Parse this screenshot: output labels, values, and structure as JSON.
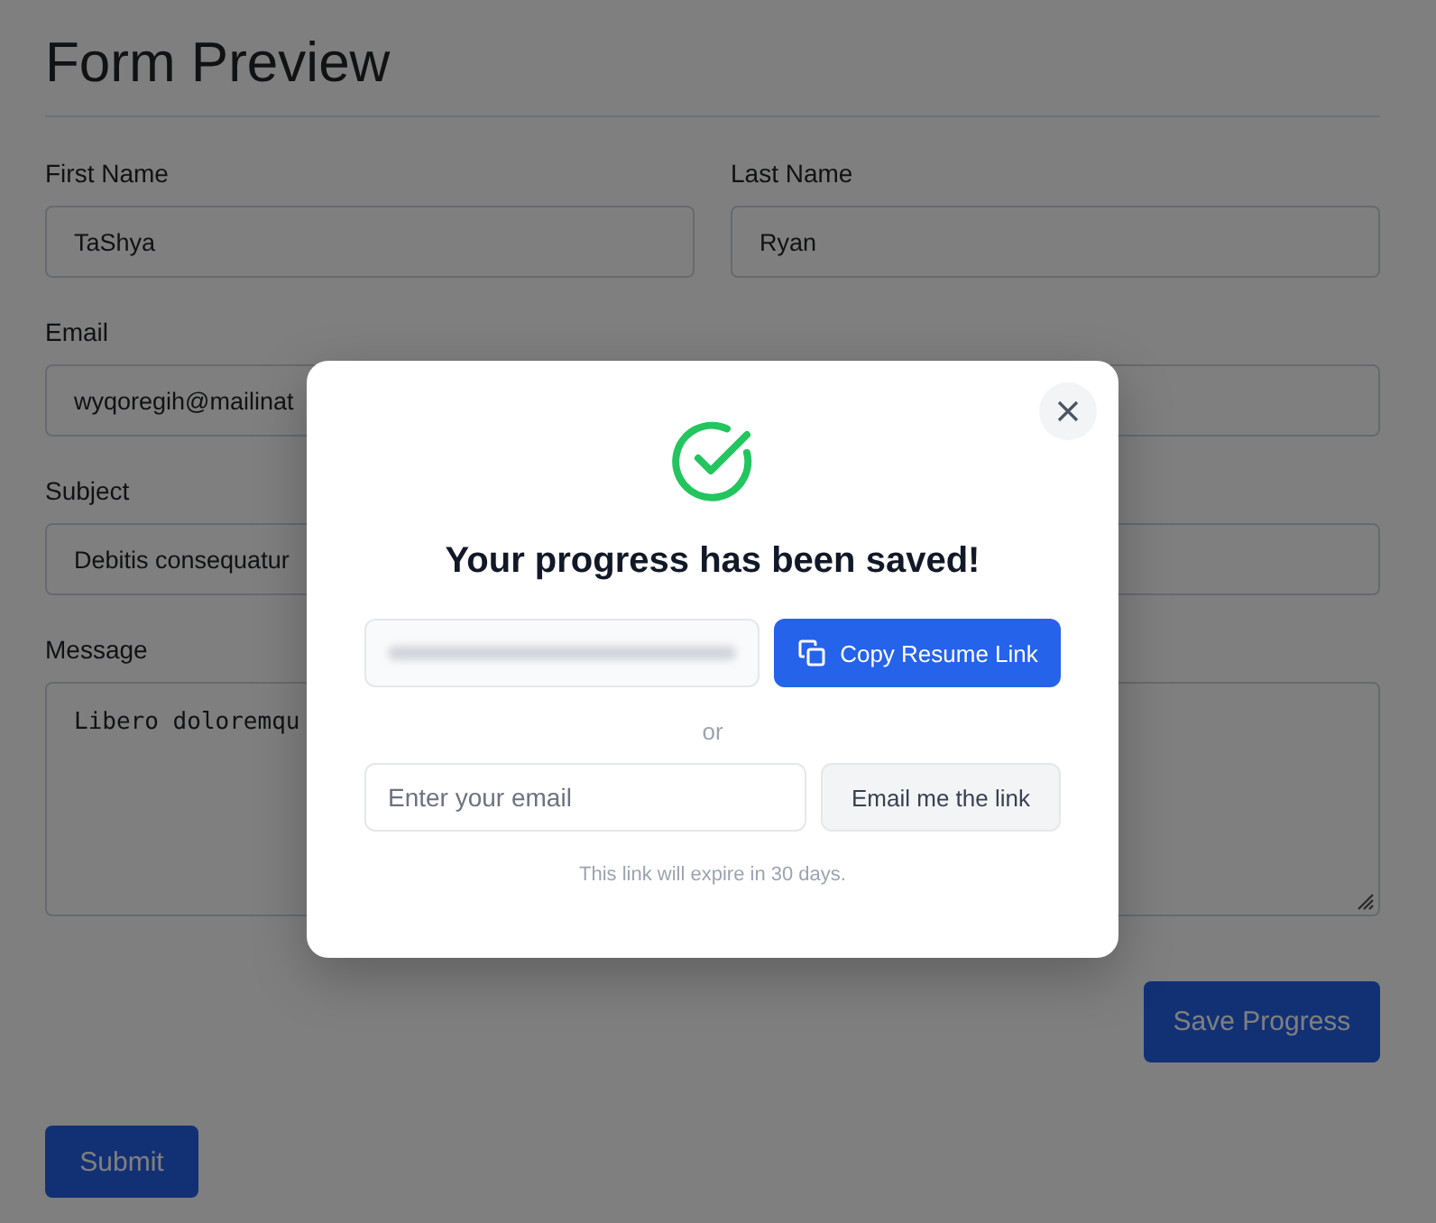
{
  "form": {
    "title": "Form Preview",
    "fields": [
      {
        "kind": "half",
        "label": "First Name",
        "value": "TaShya"
      },
      {
        "kind": "half",
        "label": "Last Name",
        "value": "Ryan"
      },
      {
        "kind": "full",
        "label": "Email",
        "value": "wyqoregih@mailinat"
      },
      {
        "kind": "full",
        "label": "Subject",
        "value": "Debitis consequatur"
      },
      {
        "kind": "textarea",
        "label": "Message",
        "value": "Libero doloremqu"
      }
    ],
    "save_button": "Save Progress",
    "submit_button": "Submit"
  },
  "dialog": {
    "title": "Your progress has been saved!",
    "copy_button": "Copy Resume Link",
    "separator": "or",
    "email_placeholder": "Enter your email",
    "email_button": "Email me the link",
    "note": "This link will expire in 30 days."
  }
}
